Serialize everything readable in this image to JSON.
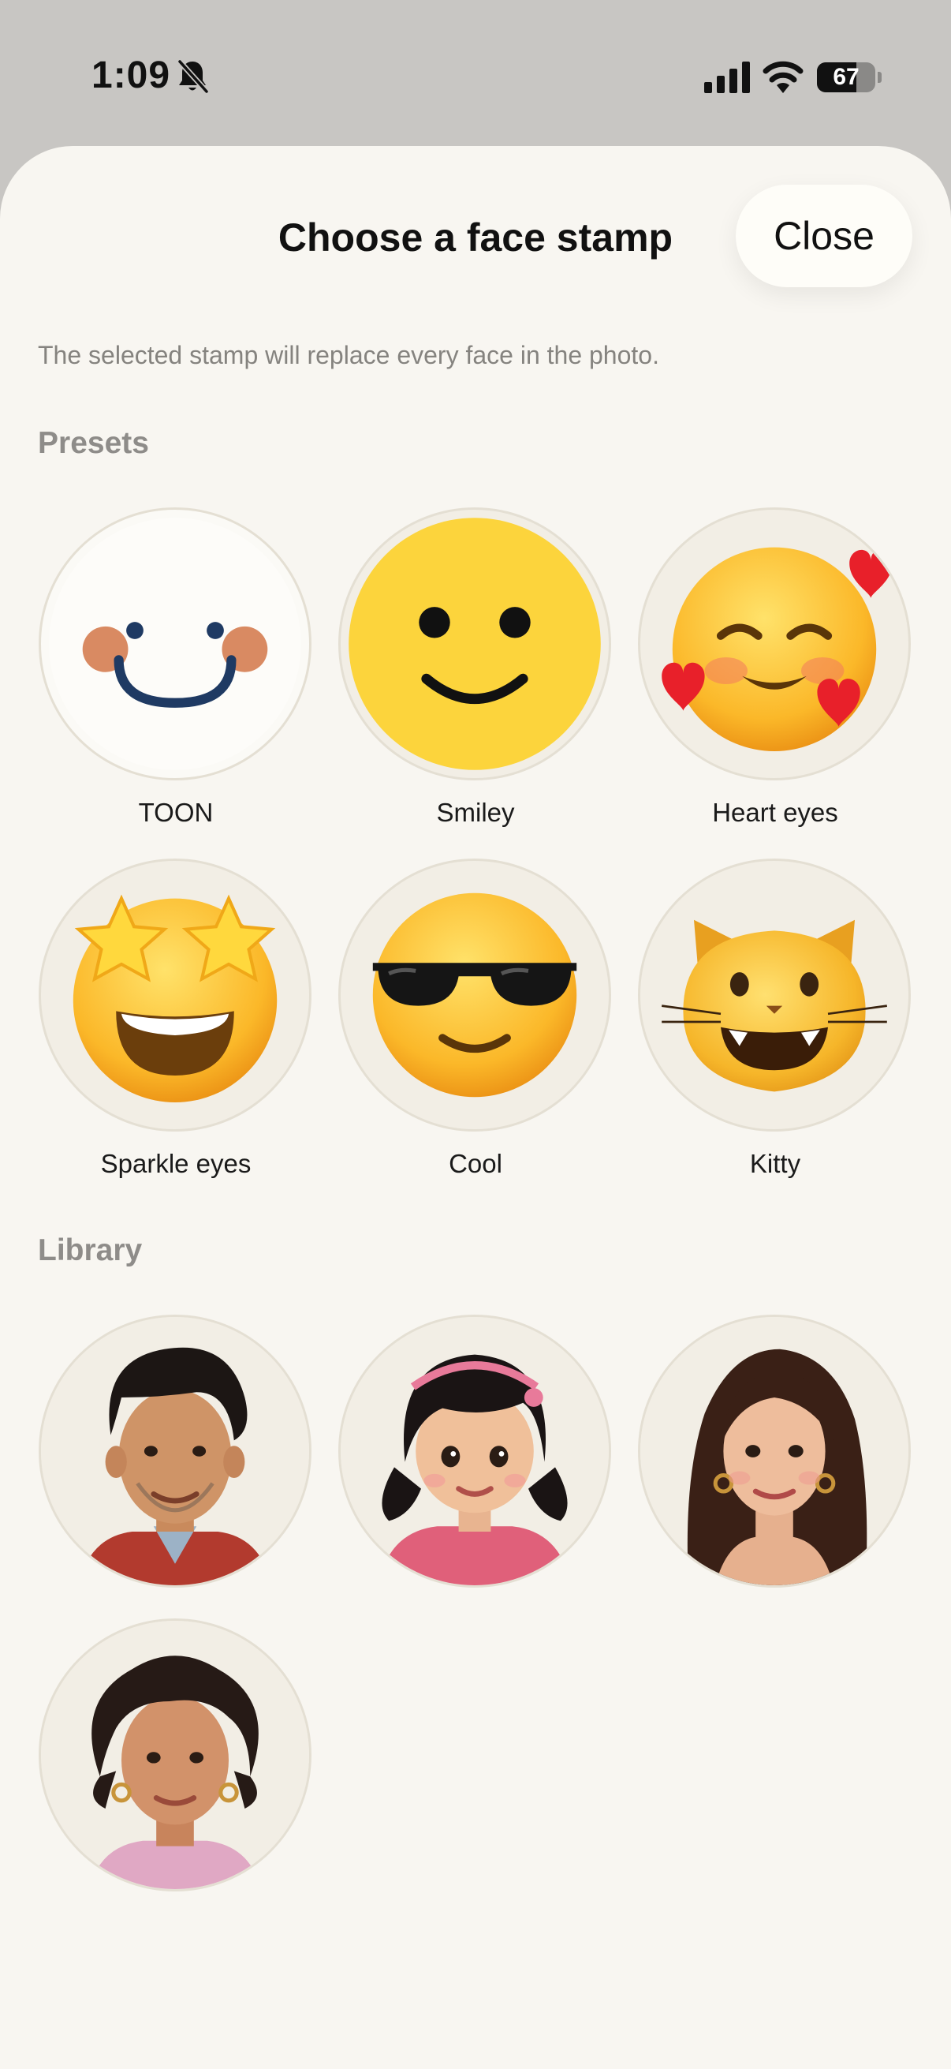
{
  "status_bar": {
    "time": "1:09",
    "battery": "67",
    "battery_level": 0.67
  },
  "sheet": {
    "title": "Choose a face stamp",
    "close_label": "Close",
    "subtitle": "The selected stamp will replace every face in the photo."
  },
  "presets": {
    "label": "Presets",
    "items": [
      {
        "label": "TOON",
        "icon": "toon-face-icon"
      },
      {
        "label": "Smiley",
        "icon": "smiley-face-icon"
      },
      {
        "label": "Heart eyes",
        "icon": "smiling-face-with-hearts-icon"
      },
      {
        "label": "Sparkle eyes",
        "icon": "star-struck-face-icon"
      },
      {
        "label": "Cool",
        "icon": "sunglasses-face-icon"
      },
      {
        "label": "Kitty",
        "icon": "grinning-cat-face-icon"
      }
    ]
  },
  "library": {
    "label": "Library",
    "items": [
      {
        "name": "library-portrait-man"
      },
      {
        "name": "library-portrait-girl"
      },
      {
        "name": "library-portrait-woman"
      },
      {
        "name": "library-portrait-older-woman"
      }
    ]
  },
  "colors": {
    "sheet_background": "#f8f6f1",
    "stamp_circle": "#f2eee5",
    "smiley_yellow": "#fcd43c",
    "toon_navy": "#1f3a63",
    "toon_cheek": "#d98a62"
  }
}
